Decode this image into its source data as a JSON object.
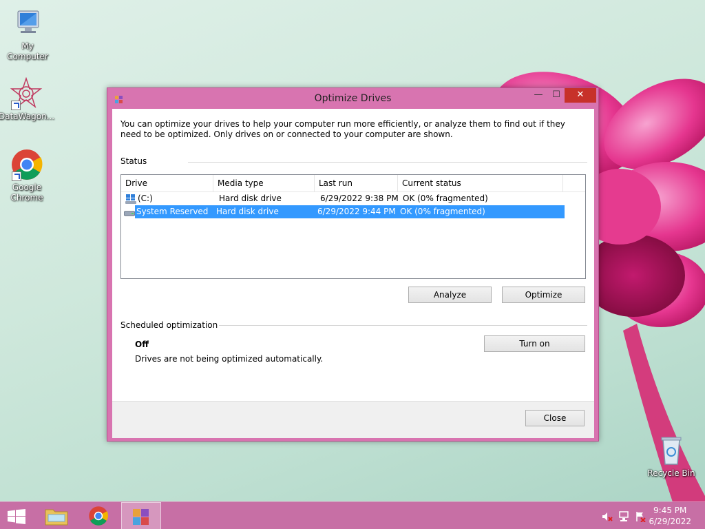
{
  "desktop": {
    "icons": [
      {
        "label": "My Computer"
      },
      {
        "label": "DataWagon..."
      },
      {
        "label": "Google Chrome"
      },
      {
        "label": "Recycle Bin"
      }
    ]
  },
  "window": {
    "title": "Optimize Drives",
    "controls": {
      "minimize": "—",
      "maximize": "☐",
      "close": "✕"
    },
    "description": "You can optimize your drives to help your computer run more efficiently, or analyze them to find out if they need to be optimized. Only drives on or connected to your computer are shown.",
    "status_label": "Status",
    "columns": [
      "Drive",
      "Media type",
      "Last run",
      "Current status"
    ],
    "drives": [
      {
        "drive": "(C:)",
        "media": "Hard disk drive",
        "last_run": "6/29/2022 9:38 PM",
        "status": "OK (0% fragmented)"
      },
      {
        "drive": "System Reserved",
        "media": "Hard disk drive",
        "last_run": "6/29/2022 9:44 PM",
        "status": "OK (0% fragmented)"
      }
    ],
    "analyze_label": "Analyze",
    "optimize_label": "Optimize",
    "scheduled_label": "Scheduled optimization",
    "scheduled_state": "Off",
    "scheduled_desc": "Drives are not being optimized automatically.",
    "turn_on_label": "Turn on",
    "close_label": "Close"
  },
  "taskbar": {
    "time": "9:45 PM",
    "date": "6/29/2022"
  },
  "colors": {
    "accent": "#d874b0",
    "taskbar": "#c76fa5",
    "selection": "#3399ff",
    "close_button": "#c7312a"
  }
}
